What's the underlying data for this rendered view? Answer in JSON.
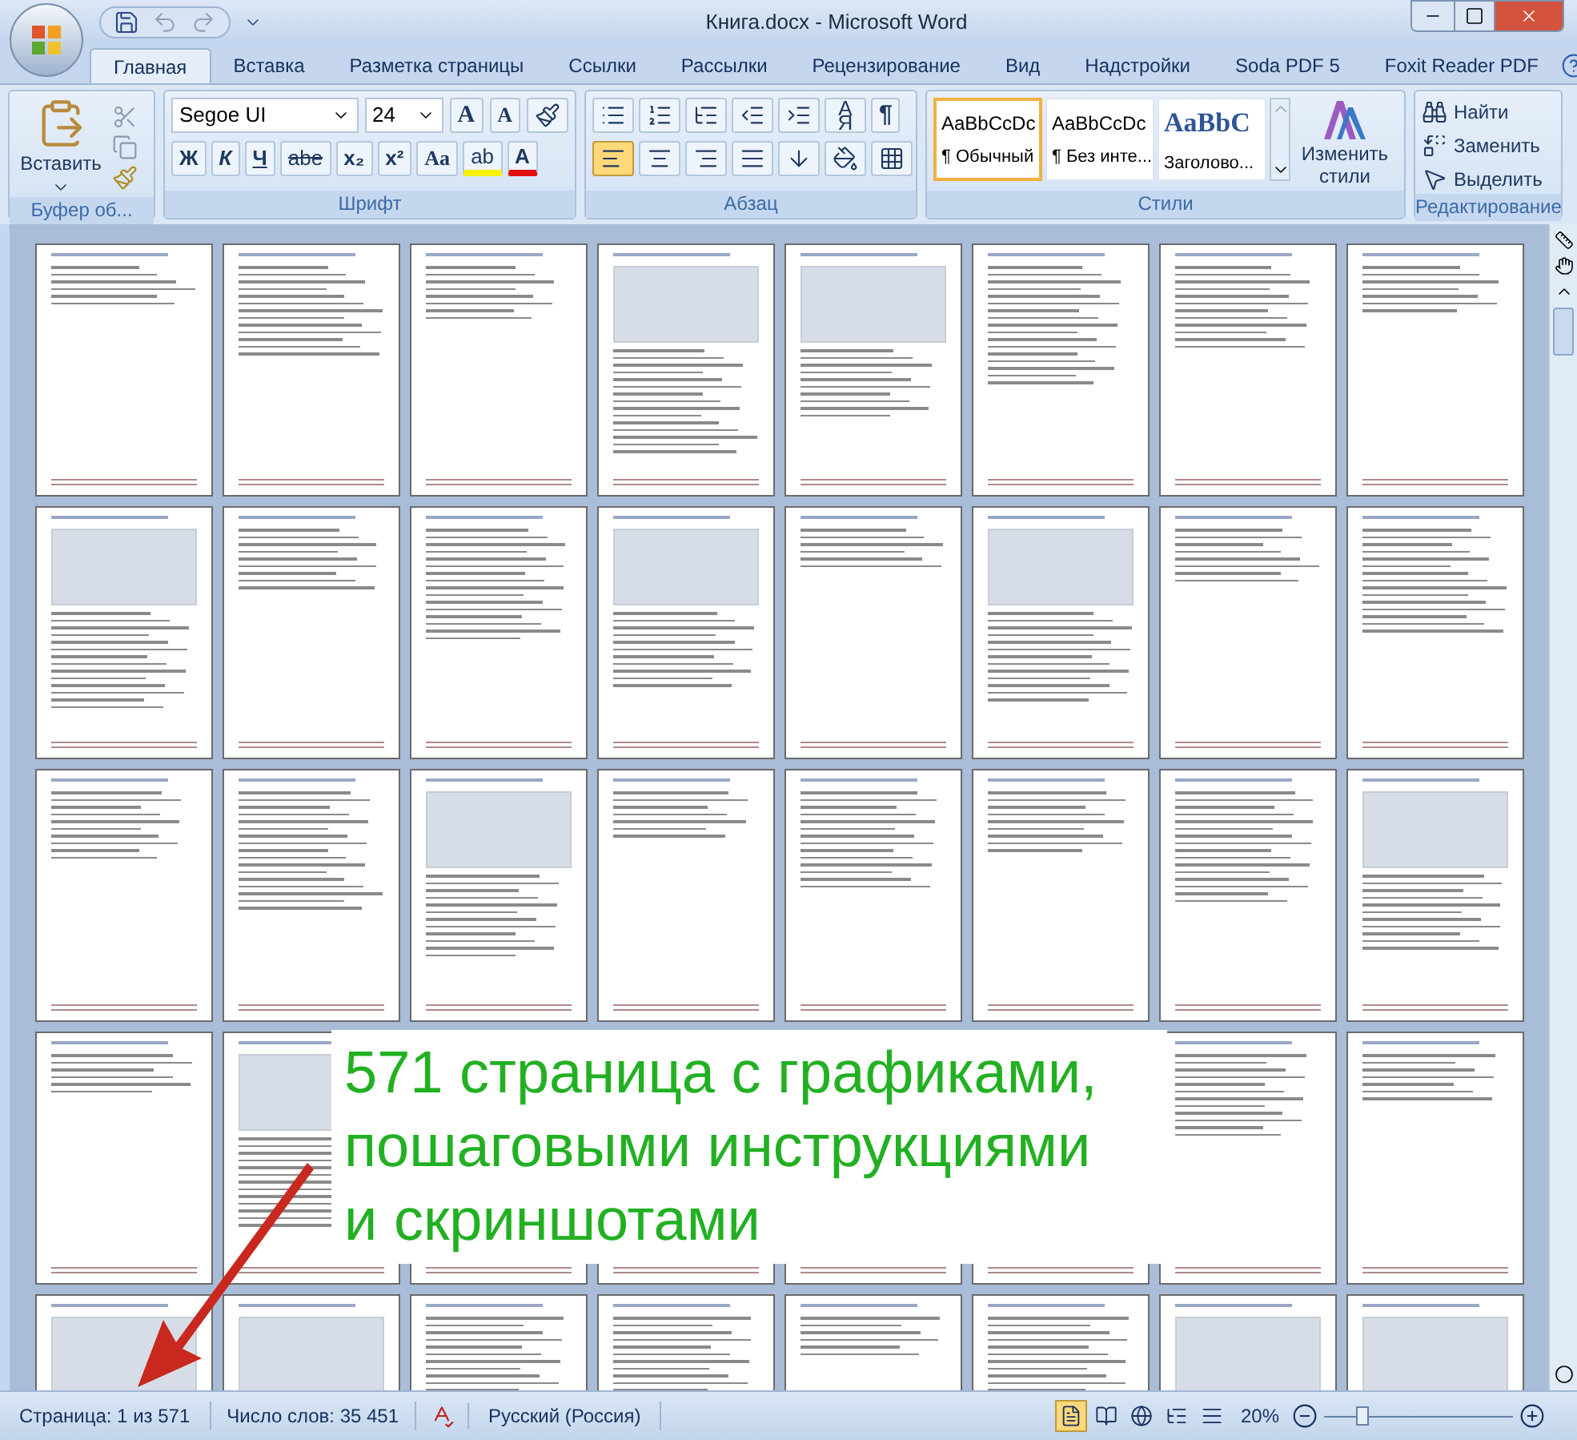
{
  "window": {
    "title": "Книга.docx - Microsoft Word"
  },
  "tabs": [
    {
      "label": "Главная",
      "selected": true
    },
    {
      "label": "Вставка",
      "selected": false
    },
    {
      "label": "Разметка страницы",
      "selected": false
    },
    {
      "label": "Ссылки",
      "selected": false
    },
    {
      "label": "Рассылки",
      "selected": false
    },
    {
      "label": "Рецензирование",
      "selected": false
    },
    {
      "label": "Вид",
      "selected": false
    },
    {
      "label": "Надстройки",
      "selected": false
    },
    {
      "label": "Soda PDF 5",
      "selected": false
    },
    {
      "label": "Foxit Reader PDF",
      "selected": false
    }
  ],
  "clipboard": {
    "paste": "Вставить",
    "group": "Буфер об..."
  },
  "font": {
    "name": "Segoe UI",
    "size": "24",
    "grow": "A",
    "shrink": "A",
    "bold": "Ж",
    "italic": "К",
    "underline": "Ч",
    "strike": "abe",
    "subscript": "x₂",
    "superscript": "x²",
    "case": "Aa",
    "highlight": "ab",
    "font_color_glyph": "A",
    "group": "Шрифт"
  },
  "paragraph": {
    "sort": "А Я",
    "marks": "¶",
    "group": "Абзац",
    "alignment": [
      {
        "kind": "left",
        "selected": true
      },
      {
        "kind": "center",
        "selected": false
      },
      {
        "kind": "right",
        "selected": false
      },
      {
        "kind": "justify",
        "selected": false
      }
    ]
  },
  "styles": {
    "group": "Стили",
    "change": "Изменить стили",
    "items": [
      {
        "preview": "AaBbCcDc",
        "name": "¶ Обычный",
        "kind": "normal",
        "selected": true
      },
      {
        "preview": "AaBbCcDc",
        "name": "¶ Без инте...",
        "kind": "normal",
        "selected": false
      },
      {
        "preview": "AaBbC",
        "name": "Заголово...",
        "kind": "heading",
        "selected": false
      }
    ]
  },
  "editing": {
    "group": "Редактирование",
    "find": "Найти",
    "replace": "Заменить",
    "select": "Выделить"
  },
  "caption": [
    "571 страница с графиками,",
    "пошаговыми инструкциями",
    "и скриншотами"
  ],
  "status_bar": {
    "page": "Страница: 1 из 571",
    "words": "Число слов: 35 451",
    "language": "Русский (Россия)",
    "zoom": "20%",
    "zoom_level": {
      "level": 0.2
    },
    "views": [
      {
        "kind": "print",
        "selected": true
      },
      {
        "kind": "reading",
        "selected": false
      },
      {
        "kind": "web",
        "selected": false
      },
      {
        "kind": "outline",
        "selected": false
      },
      {
        "kind": "draft",
        "selected": false
      }
    ]
  }
}
